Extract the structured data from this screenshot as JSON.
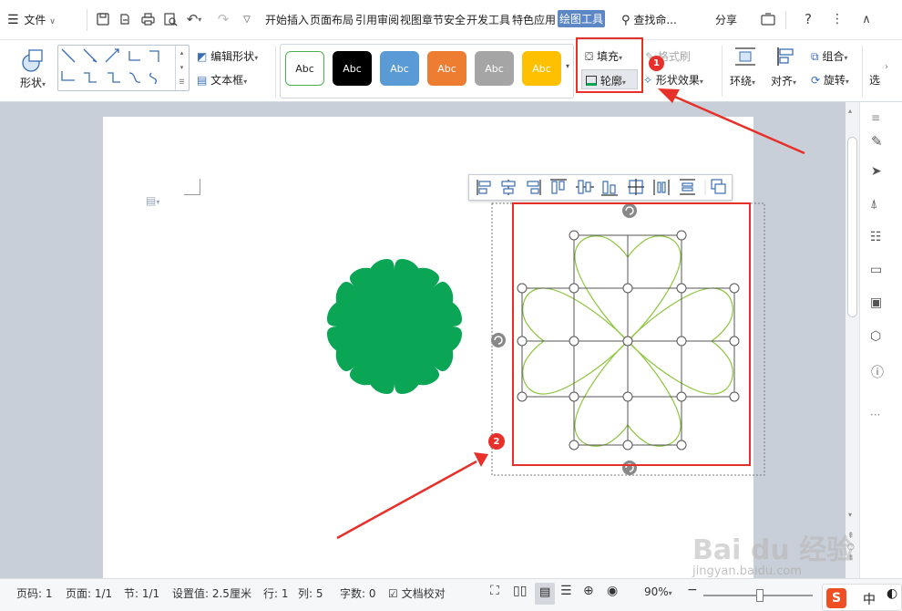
{
  "menubar": {
    "file_label": "文件",
    "tabs": [
      "开始",
      "插入",
      "页面布局",
      "引用",
      "审阅",
      "视图",
      "章节",
      "安全",
      "开发工具",
      "特色应用",
      "绘图工具"
    ],
    "search_label": "查找命...",
    "share_label": "分享",
    "active_tab_color": "#5b87c7"
  },
  "ribbon": {
    "shape_label": "形状",
    "edit_shape_label": "编辑形状",
    "textbox_label": "文本框",
    "style_swatches": [
      {
        "label": "Abc",
        "bg": "#ffffff",
        "fg": "#222222",
        "border": "#4caf50"
      },
      {
        "label": "Abc",
        "bg": "#000000",
        "fg": "#ffffff",
        "border": "#000000"
      },
      {
        "label": "Abc",
        "bg": "#5b9bd5",
        "fg": "#ffffff",
        "border": "#4a8bc5"
      },
      {
        "label": "Abc",
        "bg": "#ed7d31",
        "fg": "#ffffff",
        "border": "#d86d21"
      },
      {
        "label": "Abc",
        "bg": "#a5a5a5",
        "fg": "#ffffff",
        "border": "#959595"
      },
      {
        "label": "Abc",
        "bg": "#ffc000",
        "fg": "#ffffff",
        "border": "#e8ae00"
      }
    ],
    "fill_label": "填充",
    "outline_label": "轮廓",
    "format_brush_label": "格式刷",
    "shape_effects_label": "形状效果",
    "wrap_label": "环绕",
    "align_label": "对齐",
    "group_label": "组合",
    "rotate_label": "旋转",
    "more_label": "选"
  },
  "annotations": {
    "badge_1": "1",
    "badge_2": "2",
    "accent": "#e8302a"
  },
  "shapes": {
    "fill_color": "#0aa555",
    "outline_color": "#8dc63f"
  },
  "status": {
    "page_code": "页码: 1",
    "page": "页面: 1/1",
    "section": "节: 1/1",
    "setting": "设置值: 2.5厘米",
    "row": "行: 1",
    "col": "列: 5",
    "word_count": "字数: 0",
    "proofread": "文档校对",
    "zoom": "90%"
  },
  "watermark": {
    "brand": "Bai du 经验",
    "url": "jingyan.baidu.com"
  },
  "ime": {
    "mode": "中"
  }
}
